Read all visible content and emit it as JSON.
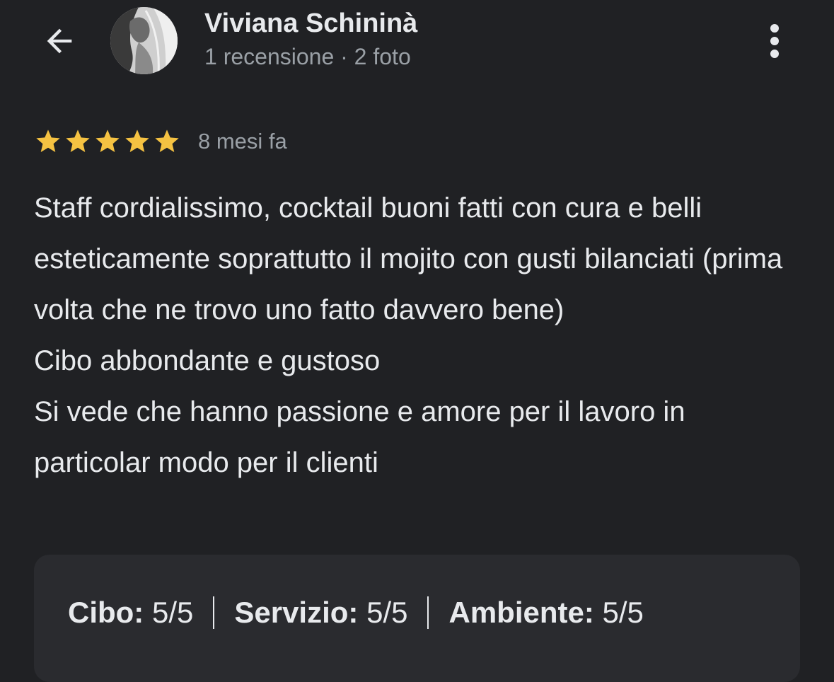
{
  "header": {
    "user_name": "Viviana Schininà",
    "reviews_count": "1 recensione",
    "separator": " · ",
    "photos_count": "2 foto"
  },
  "review": {
    "rating": 5,
    "rating_max": 5,
    "star_color": "#f5c242",
    "time_ago": "8 mesi fa",
    "paragraphs": [
      "Staff cordialissimo, cocktail buoni fatti con cura e belli esteticamente soprattutto il mojito con gusti bilanciati (prima volta che ne trovo uno fatto davvero bene)",
      "Cibo abbondante e gustoso",
      "Si vede che hanno passione e amore per il lavoro in particolar modo per il clienti"
    ]
  },
  "scores": [
    {
      "label": "Cibo:",
      "value": "5/5"
    },
    {
      "label": "Servizio:",
      "value": "5/5"
    },
    {
      "label": "Ambiente:",
      "value": "5/5"
    }
  ],
  "icons": {
    "back": "arrow-back-icon",
    "more": "more-vertical-icon",
    "star": "star-icon"
  },
  "colors": {
    "background": "#202124",
    "card": "#2a2b2f",
    "primary_text": "#e8eaed",
    "secondary_text": "#9aa0a6"
  }
}
